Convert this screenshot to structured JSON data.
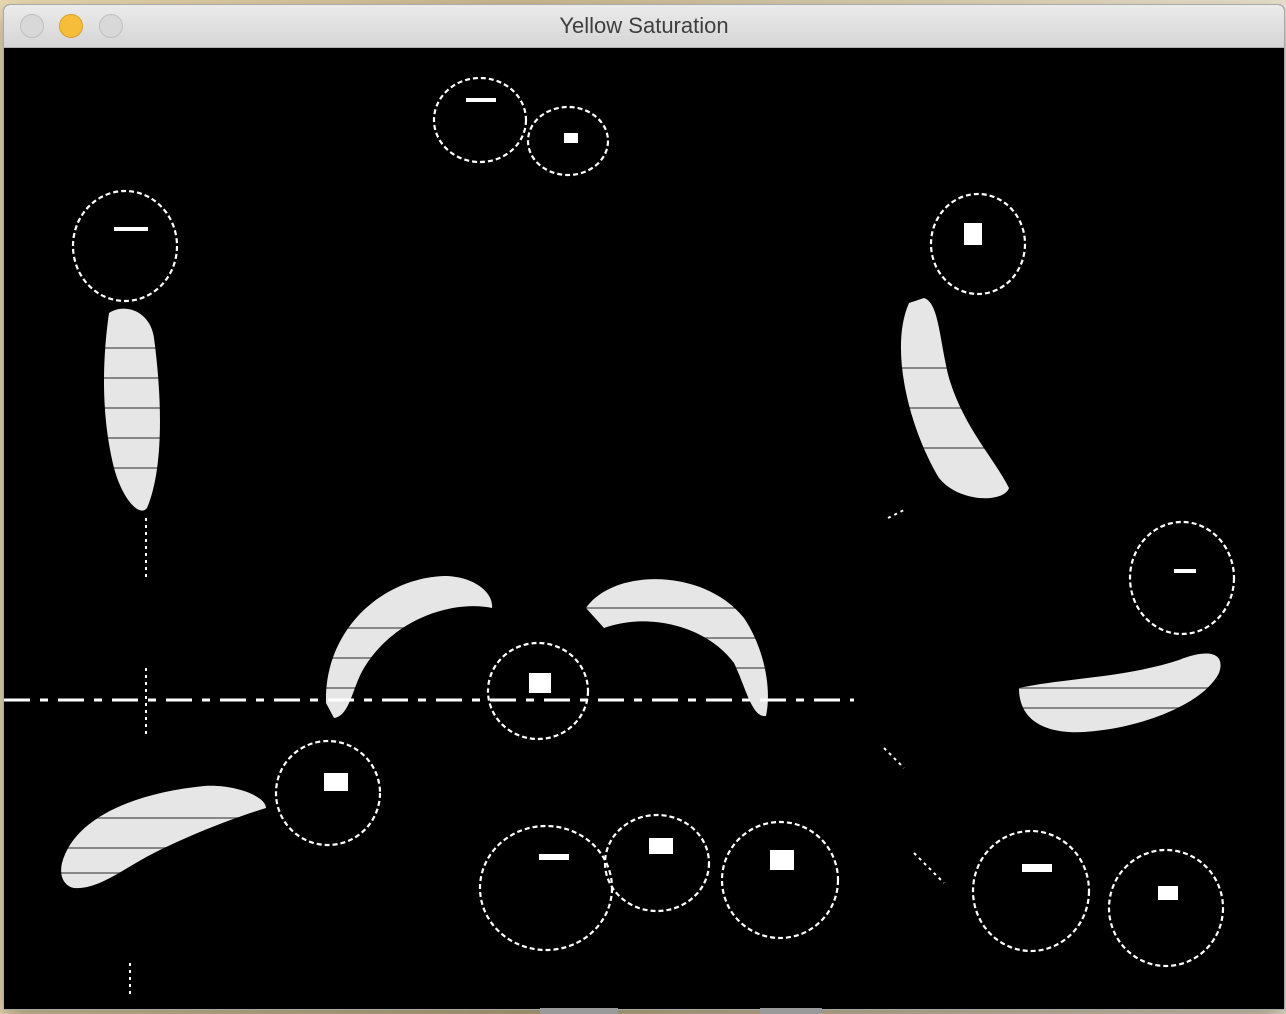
{
  "window": {
    "title": "Yellow Saturation",
    "controls": [
      "close-button",
      "minimize-button",
      "zoom-button"
    ]
  },
  "colors": {
    "canvas_background": "#000000",
    "mask_foreground": "#ffffff",
    "minimize_accent": "#f6bd3b"
  }
}
